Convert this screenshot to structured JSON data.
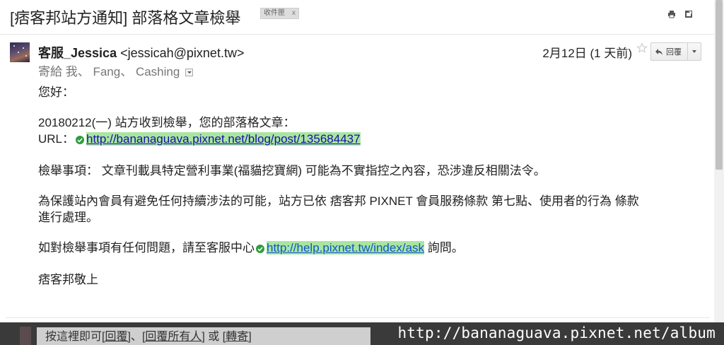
{
  "subject": {
    "title": "[痞客邦站方通知] 部落格文章檢舉",
    "label": "收件匣",
    "label_close": "x"
  },
  "toolbar": {
    "print_icon": "printer-icon",
    "newwindow_icon": "new-window-icon"
  },
  "message": {
    "sender_name": "客服_Jessica",
    "sender_email": "<jessicah@pixnet.tw>",
    "recipients_prefix": "寄給 我、",
    "recipients_rest": "Fang、 Cashing",
    "date": "2月12日 (1 天前)",
    "reply_label": "回覆"
  },
  "body": {
    "greeting": "您好：",
    "line1": "20180212(一) 站方收到檢舉，您的部落格文章：",
    "url_prefix": "URL：",
    "url": "http://bananaguava.pixnet.net/blog/post/135684437",
    "reason": "檢舉事項： 文章刊載具特定營利事業(福貓挖寶網) 可能為不實指控之內容，恐涉違反相關法令。",
    "para1": "為保護站內會員有避免任何持續涉法的可能，站方已依 痞客邦 PIXNET 會員服務條款 第七點、使用者的行為 條款",
    "para1b": "進行處理。",
    "help_prefix": "如對檢舉事項有任何問題，請至客服中心",
    "help_url": "http://help.pixnet.tw/index/ask",
    "help_suffix": "詢問。",
    "signature": "痞客邦敬上"
  },
  "reply_box": {
    "prefix": "按這裡即可",
    "reply": "[回覆]",
    "sep": "、",
    "reply_all": "[回覆所有人]",
    "or": " 或 ",
    "forward": "[轉寄]"
  },
  "watermark": "http://bananaguava.pixnet.net/album",
  "colors": {
    "link": "#1a0dab",
    "link_highlight": "#a8e6a0",
    "safe_green": "#2e9e3e",
    "bottom_strip": "#3a3a3a"
  }
}
